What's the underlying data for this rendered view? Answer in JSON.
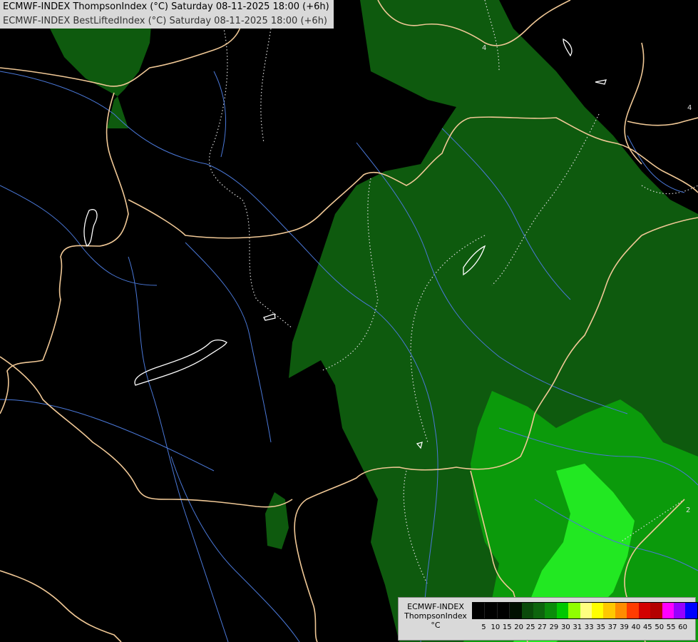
{
  "header": {
    "line1": "ECMWF-INDEX ThompsonIndex (°C) Saturday 08-11-2025 18:00 (+6h)",
    "line2": "ECMWF-INDEX BestLiftedIndex (°C) Saturday 08-11-2025 18:00 (+6h)"
  },
  "contour_labels": {
    "a": "4",
    "b": "4",
    "c": "2"
  },
  "legend": {
    "title_line1": "ECMWF-INDEX",
    "title_line2": "ThompsonIndex",
    "unit": "°C",
    "ticks": [
      "5",
      "10",
      "15",
      "20",
      "25",
      "27",
      "29",
      "30",
      "31",
      "33",
      "35",
      "37",
      "39",
      "40",
      "45",
      "50",
      "55",
      "60"
    ],
    "colors": [
      "#000000",
      "#000000",
      "#000000",
      "#001000",
      "#0a4a0a",
      "#0d640d",
      "#0a8c0a",
      "#00c800",
      "#90ff00",
      "#ffff80",
      "#ffff00",
      "#ffc800",
      "#ff8c00",
      "#ff3c00",
      "#d20000",
      "#b40000",
      "#ff00ff",
      "#9600ff",
      "#0000ff"
    ]
  },
  "colors": {
    "dark_green": "#0e5a0e",
    "mid_green": "#0b9a0b",
    "bright_green": "#22e822",
    "border": "#f0c896",
    "river": "#4a78d8",
    "lake": "#ffffff"
  }
}
